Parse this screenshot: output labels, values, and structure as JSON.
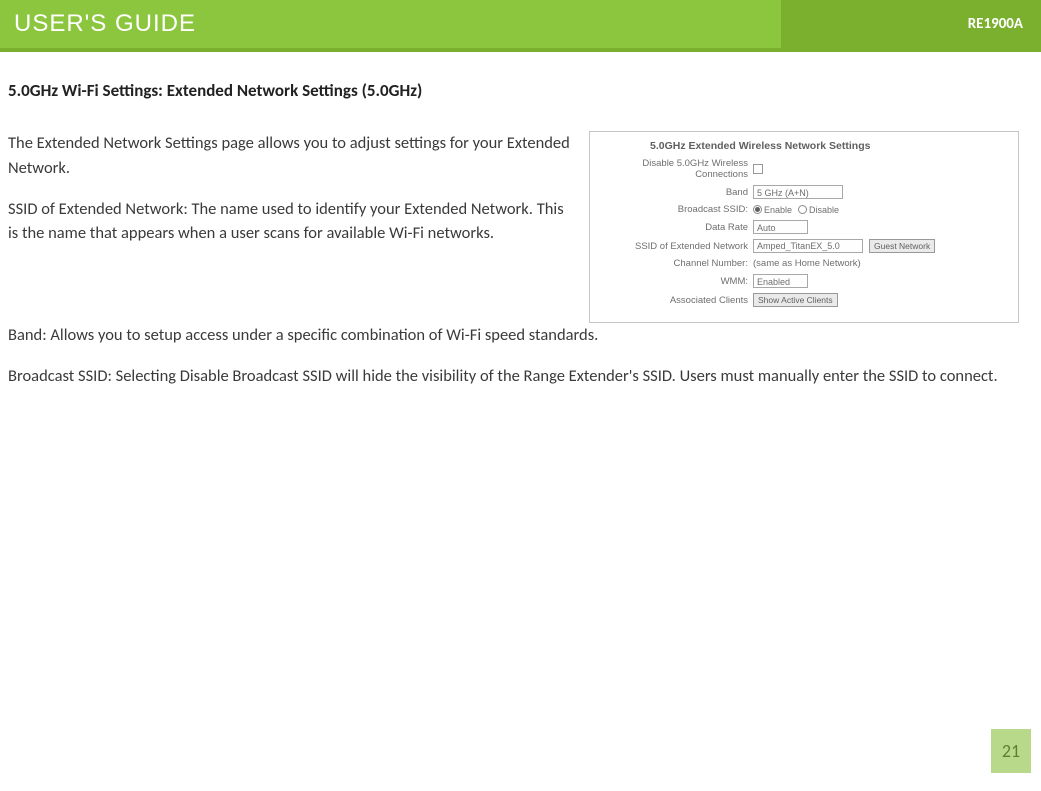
{
  "header": {
    "title": "USER'S GUIDE",
    "model": "RE1900A"
  },
  "section_title": "5.0GHz Wi-Fi Settings: Extended Network Settings (5.0GHz)",
  "paragraphs": {
    "p1": "The Extended Network Settings page allows you to adjust settings for your Extended Network.",
    "p2": "SSID of Extended Network: The name used to identify your Extended Network. This is the name that appears when a user scans for available Wi-Fi networks.",
    "p3": "Band: Allows you to setup access under a specific combination of Wi-Fi speed standards.",
    "p4": "Broadcast SSID: Selecting Disable Broadcast SSID will hide the visibility of the Range Extender's SSID. Users must manually enter the SSID to connect."
  },
  "panel": {
    "title": "5.0GHz Extended Wireless Network Settings",
    "labels": {
      "disable": "Disable 5.0GHz Wireless Connections",
      "band": "Band",
      "broadcast": "Broadcast SSID:",
      "datarate": "Data Rate",
      "ssid": "SSID of Extended Network",
      "channel": "Channel Number:",
      "wmm": "WMM:",
      "assoc": "Associated Clients"
    },
    "values": {
      "band_select": "5 GHz (A+N)",
      "enable": "Enable",
      "disable": "Disable",
      "datarate_select": "Auto",
      "ssid_value": "Amped_TitanEX_5.0",
      "guest_btn": "Guest Network",
      "channel_value": "(same as Home Network)",
      "wmm_select": "Enabled",
      "clients_btn": "Show Active Clients"
    }
  },
  "page_number": "21"
}
